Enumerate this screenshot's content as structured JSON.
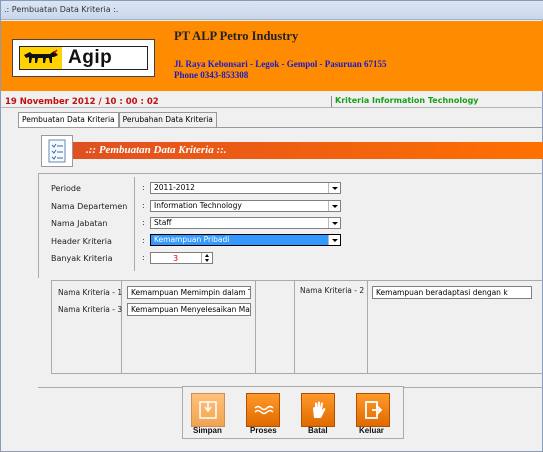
{
  "window": {
    "title": ".: Pembuatan Data Kriteria :."
  },
  "banner": {
    "logo_text": "Agip",
    "company": "PT ALP Petro Industry",
    "address_line1": "Jl. Raya Kebonsari - Legok - Gempol - Pasuruan 67155",
    "address_line2": "Phone 0343-853308"
  },
  "status": {
    "datetime": "19 November 2012 / 10 : 00 : 02",
    "department_info": "Kriteria Information Technology"
  },
  "tabs": [
    {
      "label": "Pembuatan Data Kriteria",
      "active": true
    },
    {
      "label": "Perubahan Data Kriteria",
      "active": false
    }
  ],
  "section": {
    "title": ".:: Pembuatan Data Kriteria ::."
  },
  "form": {
    "periode_label": "Periode",
    "periode_value": "2011-2012",
    "departemen_label": "Nama Departemen",
    "departemen_value": "Information Technology",
    "jabatan_label": "Nama Jabatan",
    "jabatan_value": "Staff",
    "header_label": "Header Kriteria",
    "header_value": "Kemampuan Pribadi",
    "banyak_label": "Banyak Kriteria",
    "banyak_value": "3",
    "colon": ":"
  },
  "kriteria": {
    "k1_label": "Nama Kriteria - 1",
    "k1_value": "Kemampuan Memimpin dalam Tea",
    "k2_label": "Nama Kriteria - 2",
    "k2_value": "Kemampuan beradaptasi dengan k",
    "k3_label": "Nama Kriteria - 3",
    "k3_value": "Kemampuan Menyelesaikan Masa"
  },
  "actions": {
    "simpan": "Simpan",
    "proses": "Proses",
    "batal": "Batal",
    "keluar": "Keluar"
  },
  "colors": {
    "banner": "#ff8c00",
    "header_gradient_start": "#e05020",
    "datetime": "#c01010",
    "department_info": "#18a018",
    "address": "#1a1acc"
  },
  "icons": {
    "logo": "six-legged-dog-logo",
    "section": "list-document-icon",
    "simpan": "save-disk-icon",
    "proses": "process-wave-icon",
    "batal": "hand-stop-icon",
    "keluar": "exit-arrow-icon"
  }
}
